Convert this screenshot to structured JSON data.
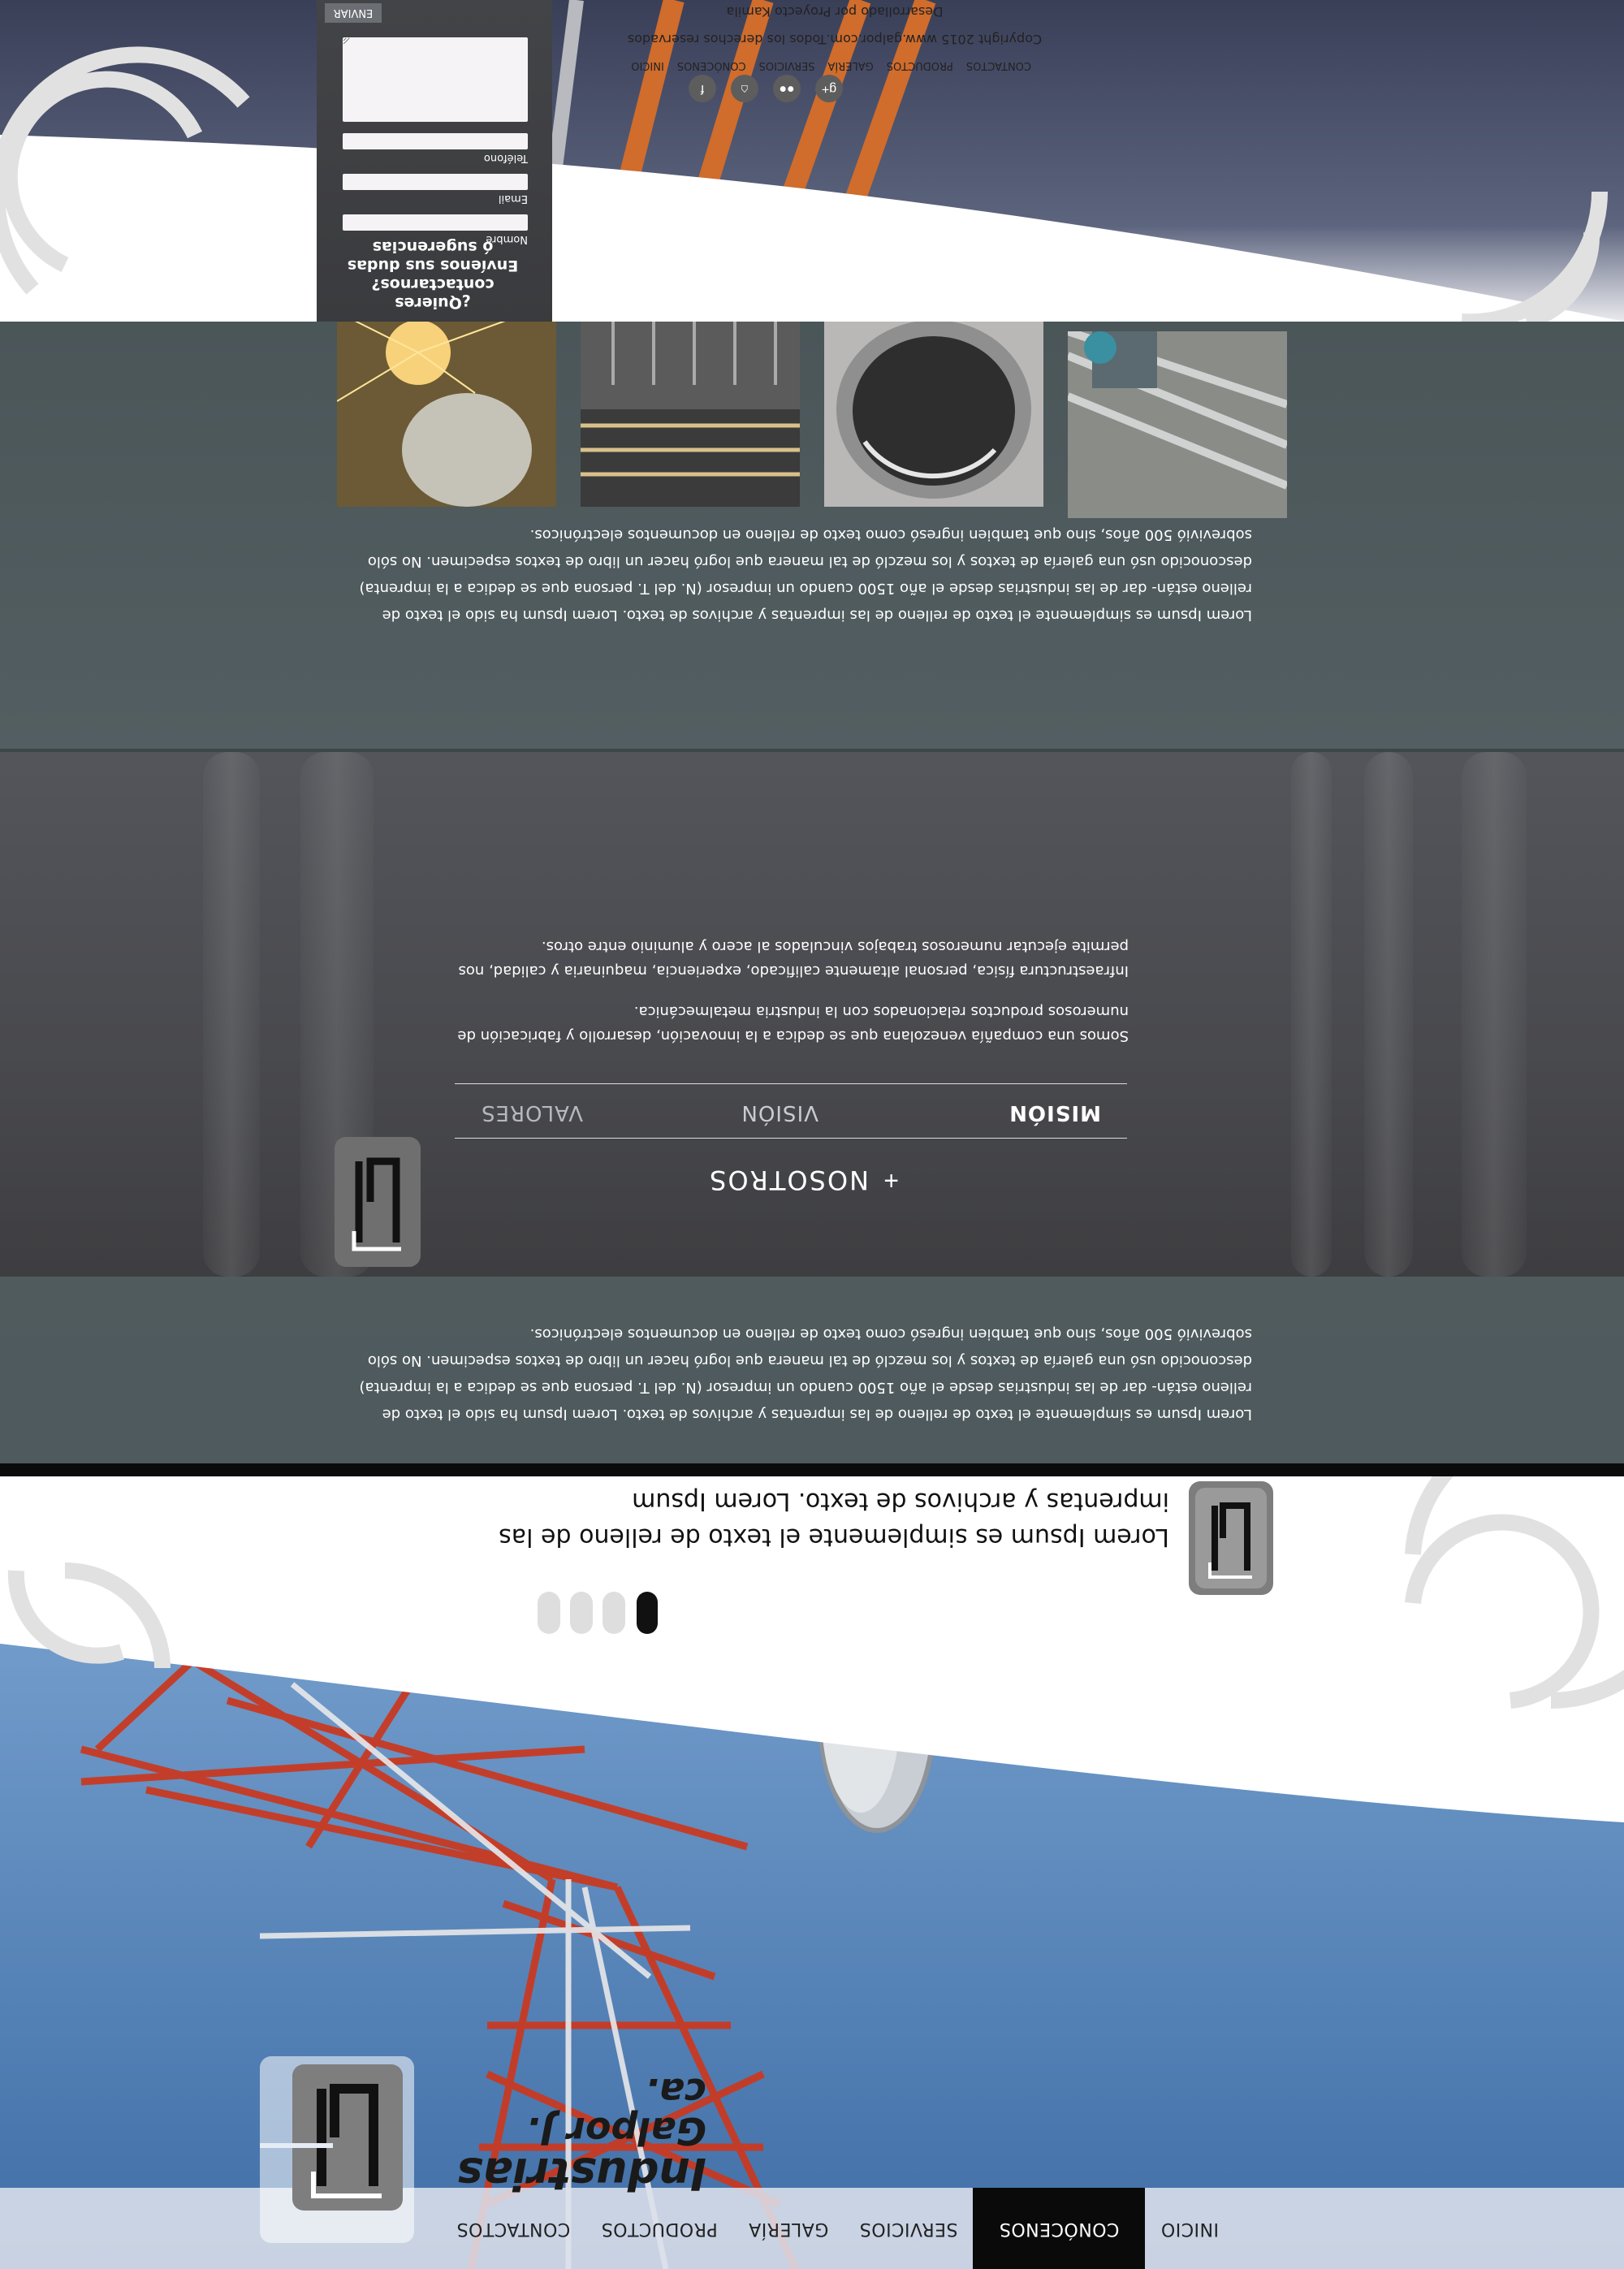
{
  "nav": {
    "items": [
      {
        "label": "INICIO"
      },
      {
        "label": "CONÓCENOS"
      },
      {
        "label": "SERVICIOS"
      },
      {
        "label": "GALERÍA"
      },
      {
        "label": "PRODUCTOS"
      },
      {
        "label": "CONTACTOS"
      }
    ],
    "active_index": 1
  },
  "brand": {
    "line1": "Industrias",
    "line2": "Galpor J. ca."
  },
  "hero": {
    "headline": "Lorem Ipsum es simplemente el texto de relleno de las imprentas y archivos de texto. Lorem Ipsum",
    "slides_total": 4,
    "active_slide": 1
  },
  "about": {
    "text": "Lorem Ipsum es simplemente el texto de relleno de las imprentas y archivos de texto. Lorem Ipsum ha sido el texto de relleno están- dar de las industrias desde el año 1500 cuando un impresor (N. del T. persona que se dedica a la imprenta) desconocido usó una galería de textos y los mezcló de tal manera que logró hacer un libro de textos especimen. No sólo sobrevivió 500 años, sino que tambien ingresó como texto de relleno en documentos electrónicos."
  },
  "nosotros": {
    "title": "NOSOTROS",
    "plus": "+",
    "tabs": [
      "MISIÓN",
      "VISIÓN",
      "VALORES"
    ],
    "active_tab": 0,
    "paragraph1": "Somos una compañía venezolana que se dedica a la innovación, desarrollo y fabricación de numerosos productos relacionados con la industria metalmecánica.",
    "paragraph2": "Infraestructura física, personal altamente calificado, experiencia, maquinaria y calidad, nos permite ejecutar numerosos trabajos vinculados al acero y aluminio entre otros."
  },
  "gallery": {
    "text": "Lorem Ipsum es simplemente el texto de relleno de las imprentas y archivos de texto. Lorem Ipsum ha sido el texto de relleno están- dar de las industrias desde el año 1500 cuando un impresor (N. del T. persona que se dedica a la imprenta) desconocido usó una galería de textos y los mezcló de tal manera que logró hacer un libro de textos especimen. No sólo sobrevivió 500 años, sino que tambien ingresó como texto de relleno en documentos electrónicos.",
    "photos": [
      {
        "icon": "welding-photo"
      },
      {
        "icon": "steel-structure-photo"
      },
      {
        "icon": "pipe-photo"
      },
      {
        "icon": "fabrication-photo"
      }
    ]
  },
  "contact": {
    "title_line1": "¿Quieres contactarnos?",
    "title_line2": "Envíenos sus dudas",
    "title_line3": "ó sugerencias",
    "name_label": "Nombre",
    "email_label": "Email",
    "phone_label": "Teléfono",
    "send_label": "ENVIAR"
  },
  "footer": {
    "social": [
      "facebook-icon",
      "home-icon",
      "flickr-icon",
      "google-plus-icon"
    ],
    "nav": [
      "INICIO",
      "CONÓCENOS",
      "SERVICIOS",
      "GALERÍA",
      "PRODUCTOS",
      "CONTACTOS"
    ],
    "copyright": "Copyright  2015 www.galpor.com.Todos los derechos reservados",
    "developer": "Desarrollado por Proyecto Kamila"
  },
  "colors": {
    "nav_bg": "#dce0eb",
    "active_nav": "#0a0a0a",
    "band": "#4f5b5e",
    "contact_panel": "#3c3d40"
  }
}
